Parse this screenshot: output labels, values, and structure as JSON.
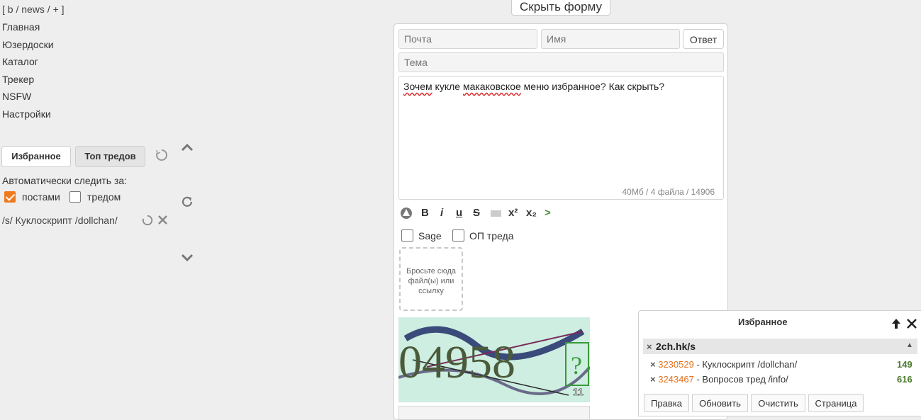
{
  "left": {
    "board_links": "[ b / news / + ]",
    "nav": [
      "Главная",
      "Юзердоски",
      "Каталог",
      "Трекер",
      "NSFW",
      "Настройки"
    ],
    "tab_favorites": "Избранное",
    "tab_top": "Топ тредов",
    "auto_follow_label": "Автоматически следить за:",
    "opt_posts": "постами",
    "opt_posts_checked": true,
    "opt_thread": "тредом",
    "opt_thread_checked": false,
    "thread_item": "/s/ Куклоскрипт /dollchan/"
  },
  "form": {
    "hide_button": "Скрыть форму",
    "email_placeholder": "Почта",
    "name_placeholder": "Имя",
    "reply_button": "Ответ",
    "subject_placeholder": "Тема",
    "message_parts": [
      "Зочем",
      " кукле ",
      "макаковское",
      " меню избранное? Как скрыть?"
    ],
    "counter": "40Мб / 4 файла / 14906",
    "toolbar": {
      "bold": "B",
      "italic": "i",
      "underline": "u",
      "strike": "S",
      "sup": "x²",
      "sub": "x₂",
      "quote": ">"
    },
    "sage_label": "Sage",
    "op_label": "ОП треда",
    "dropzone_text": "Бросьте сюда файл(ы) или ссылку",
    "captcha_text": "04958",
    "captcha_badge": "11",
    "captcha_q": "?"
  },
  "favorites": {
    "title": "Избранное",
    "host": "2ch.hk/s",
    "items": [
      {
        "num": "3230529",
        "title": " - Куклоскрипт /dollchan/",
        "count": "149"
      },
      {
        "num": "3243467",
        "title": " - Вопросов тред /info/",
        "count": "616"
      }
    ],
    "buttons": [
      "Правка",
      "Обновить",
      "Очистить",
      "Страница"
    ]
  },
  "colors": {
    "accent": "#f07a1e",
    "count_green": "#4b7a2e",
    "captcha_bg": "#cdeee0"
  }
}
